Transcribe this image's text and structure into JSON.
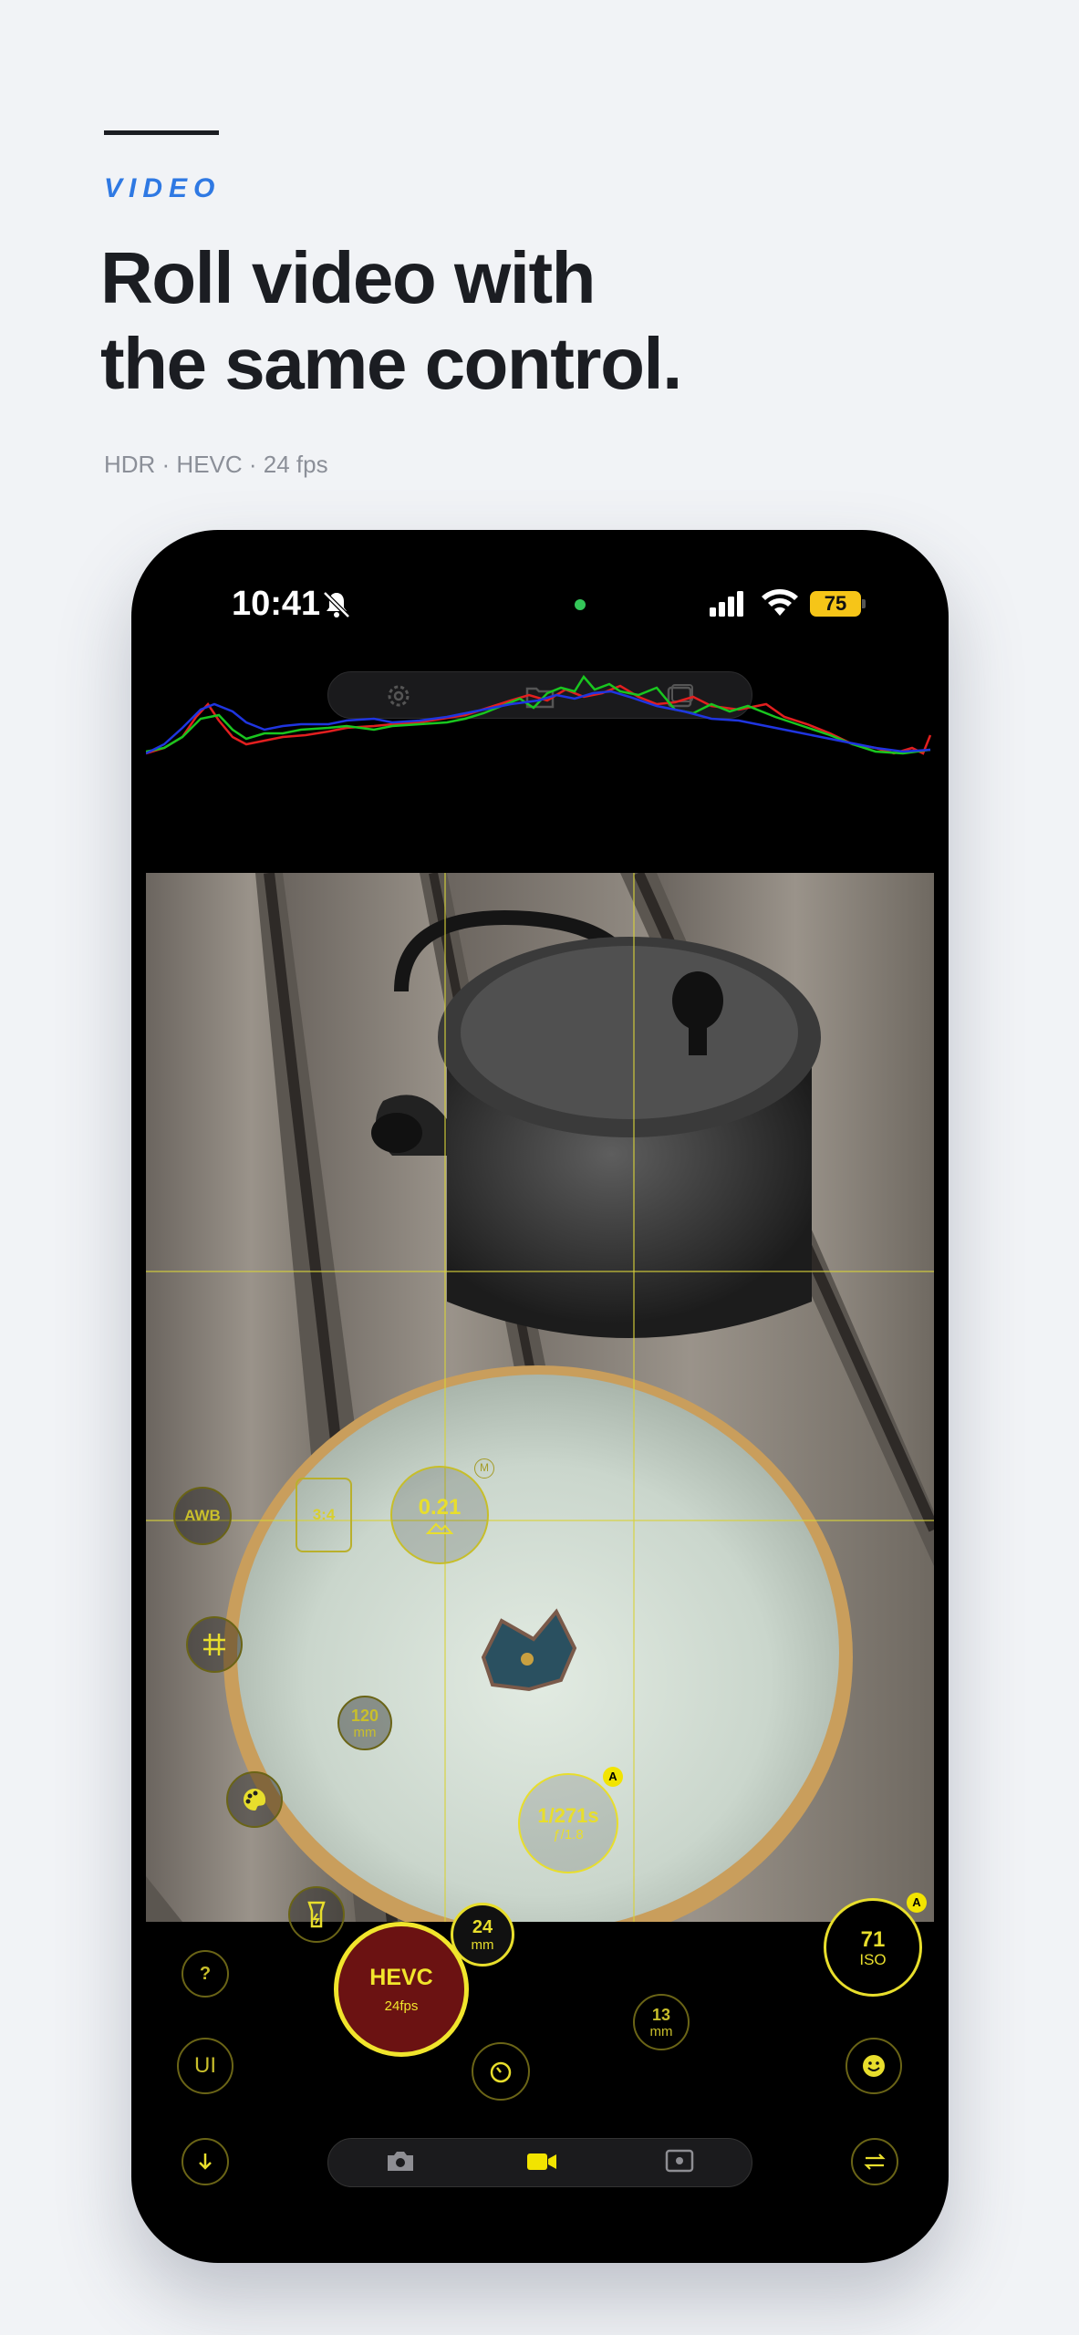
{
  "header": {
    "eyebrow": "VIDEO",
    "headline_line1": "Roll video with",
    "headline_line2": "the same control.",
    "subline": "HDR · HEVC · 24 fps"
  },
  "status_bar": {
    "time": "10:41",
    "battery": "75"
  },
  "viewfinder_controls": {
    "awb": "AWB",
    "aspect": "3:4",
    "ev_value": "0.21",
    "manual_badge": "M",
    "zoom_120": {
      "value": "120",
      "unit": "mm"
    },
    "shutter": {
      "value": "1/271s",
      "aperture": "ƒ/1.8",
      "badge": "A"
    },
    "zoom_24": {
      "value": "24",
      "unit": "mm"
    }
  },
  "bottom_controls": {
    "help": "?",
    "ui": "UI",
    "record": {
      "format": "HEVC",
      "fps": "24fps"
    },
    "zoom_13": {
      "value": "13",
      "unit": "mm"
    },
    "iso": {
      "value": "71",
      "label": "ISO",
      "badge": "A"
    }
  },
  "colors": {
    "accent_yellow": "#e8de2c",
    "eyebrow_blue": "#2f79e3",
    "record_red": "#6b1212",
    "status_green": "#34c759"
  }
}
